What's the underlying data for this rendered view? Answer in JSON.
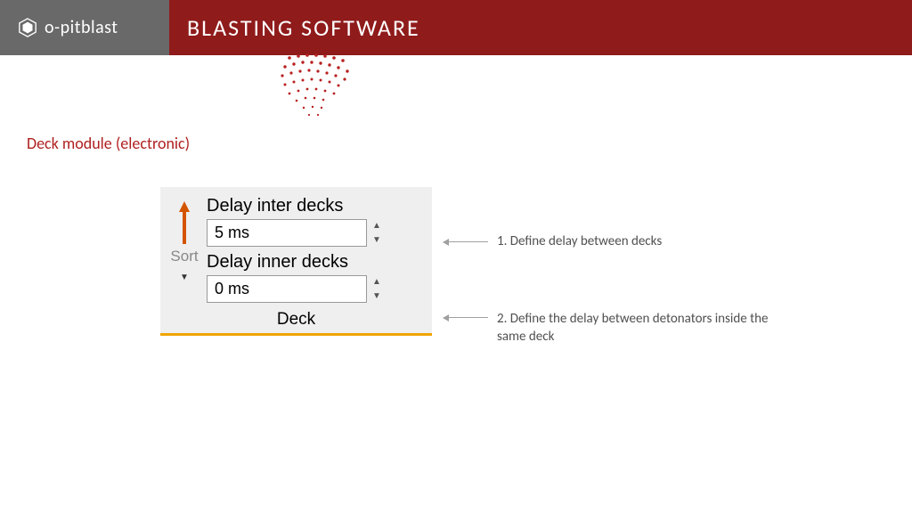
{
  "header": {
    "brand": "o-pitblast",
    "title": "BLASTING SOFTWARE"
  },
  "section": {
    "title": "Deck module (electronic)"
  },
  "panel": {
    "sort_label": "Sort",
    "field1_label": "Delay inter decks",
    "field1_value": "5 ms",
    "field2_label": "Delay inner decks",
    "field2_value": "0 ms",
    "footer": "Deck"
  },
  "annotations": {
    "a1": "1. Define delay between decks",
    "a2": "2. Define the delay between detonators inside the same deck"
  }
}
